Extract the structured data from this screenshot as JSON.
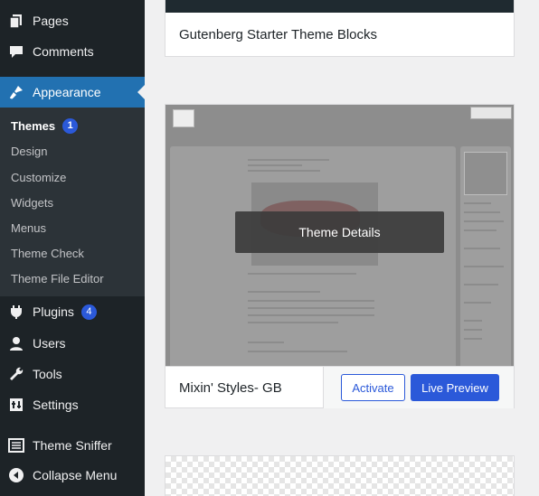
{
  "sidebar": {
    "items": [
      {
        "label": "Pages",
        "icon": "pages-icon"
      },
      {
        "label": "Comments",
        "icon": "comments-icon"
      },
      {
        "label": "Appearance",
        "icon": "appearance-icon"
      },
      {
        "label": "Plugins",
        "icon": "plugins-icon",
        "badge": "4"
      },
      {
        "label": "Users",
        "icon": "users-icon"
      },
      {
        "label": "Tools",
        "icon": "tools-icon"
      },
      {
        "label": "Settings",
        "icon": "settings-icon"
      },
      {
        "label": "Theme Sniffer",
        "icon": "theme-sniffer-icon"
      },
      {
        "label": "Collapse Menu",
        "icon": "collapse-icon"
      }
    ],
    "submenu": [
      {
        "label": "Themes",
        "badge": "1"
      },
      {
        "label": "Design"
      },
      {
        "label": "Customize"
      },
      {
        "label": "Widgets"
      },
      {
        "label": "Menus"
      },
      {
        "label": "Theme Check"
      },
      {
        "label": "Theme File Editor"
      }
    ]
  },
  "themes": [
    {
      "name": "Gutenberg Starter Theme Blocks"
    },
    {
      "name": "Mixin' Styles- GB",
      "overlay": "Theme Details",
      "activate_label": "Activate",
      "preview_label": "Live Preview"
    }
  ],
  "colors": {
    "accent": "#2b59d9",
    "sidebar_bg": "#1d2327",
    "current_bg": "#2271b1"
  }
}
